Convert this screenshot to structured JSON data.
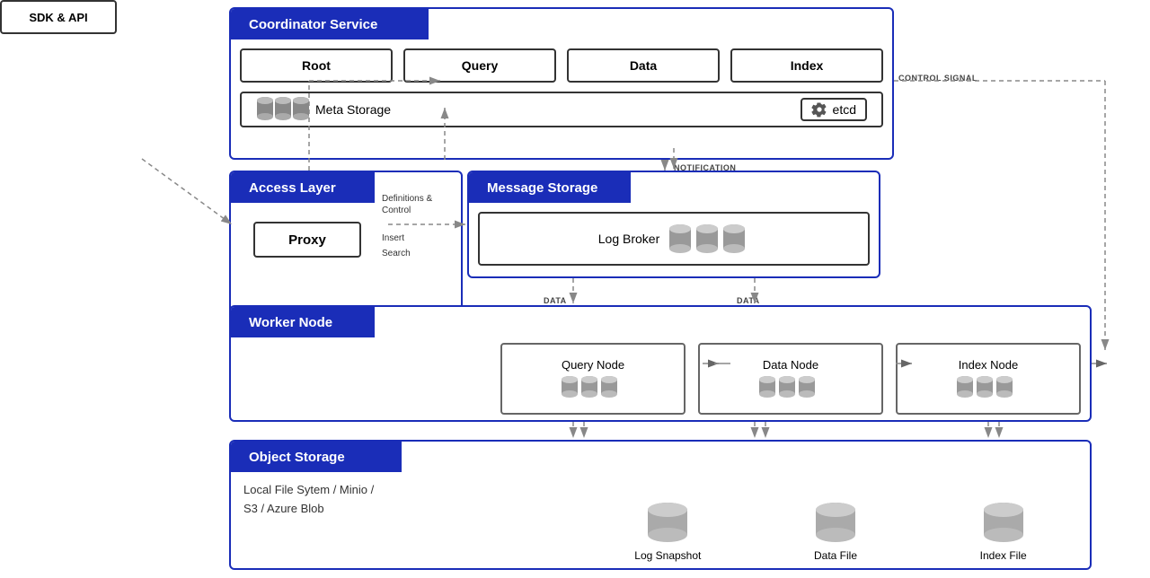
{
  "sdk": {
    "label": "SDK & API"
  },
  "coordinator": {
    "title": "Coordinator Service",
    "nodes": [
      "Root",
      "Query",
      "Data",
      "Index"
    ],
    "meta_storage_label": "Meta Storage",
    "etcd_label": "etcd",
    "control_signal": "CONTROL SIGNAL"
  },
  "access": {
    "title": "Access Layer",
    "proxy_label": "Proxy",
    "def_control": "Definitions &\nControl",
    "insert_label": "Insert",
    "search_label": "Search"
  },
  "message": {
    "title": "Message Storage",
    "log_broker": "Log Broker",
    "notification": "NOTIFICATION"
  },
  "worker": {
    "title": "Worker Node",
    "nodes": [
      {
        "label": "Query Node"
      },
      {
        "label": "Data Node"
      },
      {
        "label": "Index Node"
      }
    ],
    "data_label_1": "DATA",
    "data_label_2": "DATA"
  },
  "object_storage": {
    "title": "Object Storage",
    "description": "Local File Sytem / Minio /\nS3 / Azure Blob",
    "items": [
      {
        "label": "Log Snapshot"
      },
      {
        "label": "Data File"
      },
      {
        "label": "Index File"
      }
    ]
  }
}
